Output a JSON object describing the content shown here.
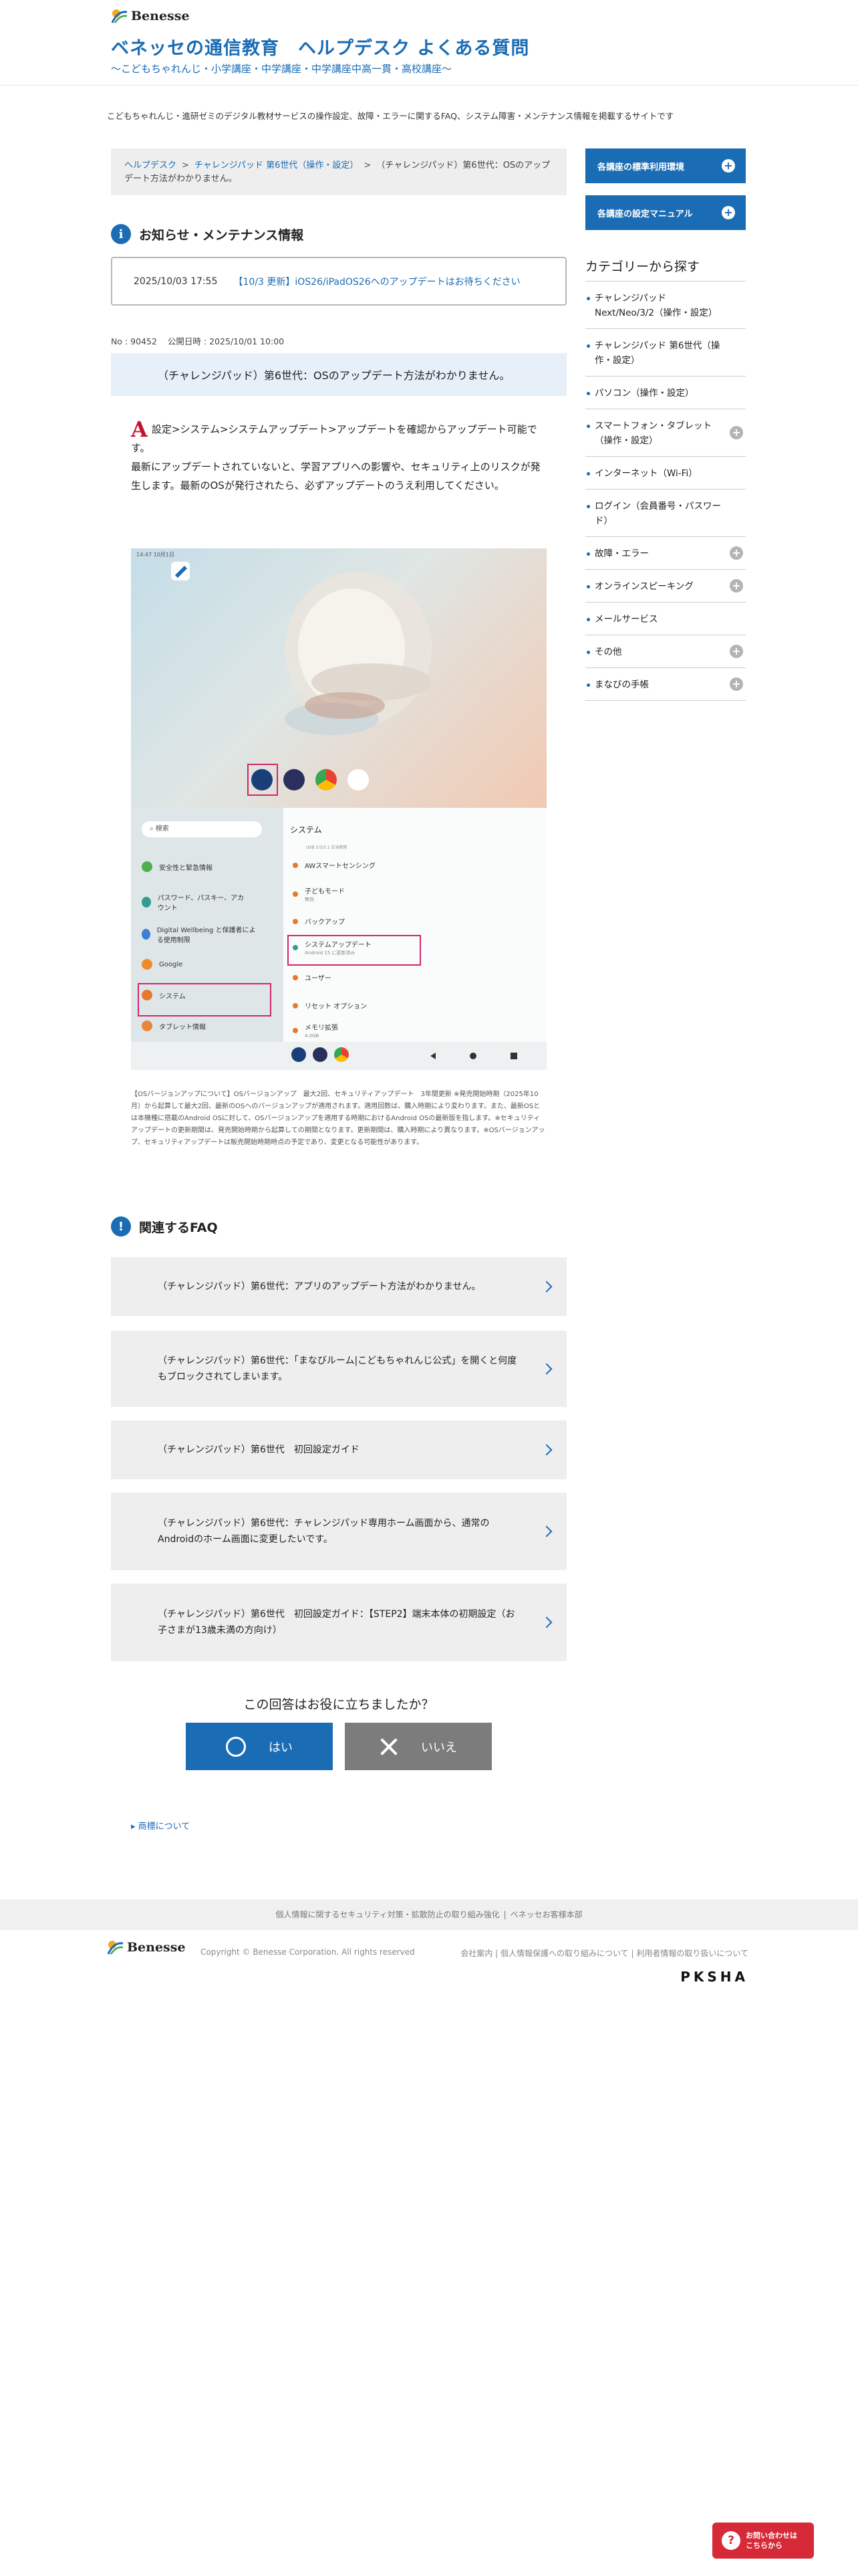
{
  "header": {
    "logo_text": "Benesse",
    "title": "ベネッセの通信教育　ヘルプデスク よくある質問",
    "subtitle": "〜こどもちゃれんじ・小学講座・中学講座・中学講座中高一貫・高校講座〜"
  },
  "intro": "こどもちゃれんじ・進研ゼミのデジタル教材サービスの操作設定、故障・エラーに関するFAQ、システム障害・メンテナンス情報を掲載するサイトです",
  "breadcrumb": {
    "home": "ヘルプデスク",
    "category": "チャレンジパッド 第6世代（操作・設定）",
    "current": "（チャレンジパッド）第6世代：OSのアップデート方法がわかりません。"
  },
  "notice": {
    "heading": "お知らせ・メンテナンス情報",
    "date": "2025/10/03 17:55",
    "link": "【10/3 更新】iOS26/iPadOS26へのアップデートはお待ちください"
  },
  "meta": {
    "no": "No : 90452",
    "published": "公開日時 : 2025/10/01 10:00"
  },
  "question": "（チャレンジパッド）第6世代：OSのアップデート方法がわかりません。",
  "answer": {
    "label": "A",
    "line1": "設定>システム>システムアップデート>アップデートを確認からアップデート可能です。",
    "line2": "最新にアップデートされていないと、学習アプリへの影響や、セキュリティ上のリスクが発生します。最新のOSが発行されたら、必ずアップデートのうえ利用してください。"
  },
  "screenshot": {
    "status_left": "14:47 10月1日",
    "search": "検索",
    "panel_title": "システム",
    "side_items": [
      "安全性と緊急情報",
      "パスワード、パスキー、アカウント",
      "Digital Wellbeing と保護者による使用制限",
      "Google",
      "システム",
      "タブレット情報"
    ],
    "main_items": [
      "AWスマートセンシング",
      "子どもモード",
      "バックアップ",
      "システムアップデート",
      "ユーザー",
      "リセット オプション",
      "メモリ拡張"
    ],
    "main_subs": [
      "",
      "無効",
      "",
      "Android 15 に更新済み",
      "",
      "",
      "4.0GB"
    ],
    "main_top_hint": "USB 3.0/3.1 正当使用"
  },
  "footnote": "【OSバージョンアップについて】OSバージョンアップ　最大2回、セキュリティアップデート　3年間更新 ※発売開始時期（2025年10月）から起算して最大2回、最新のOSへのバージョンアップが適用されます。適用回数は、購入時期により変わります。また、最新OSとは本機種に搭載のAndroid OSに対して、OSバージョンアップを適用する時期におけるAndroid OSの最新版を指します。※セキュリティアップデートの更新期間は、発売開始時期から起算しての期間となります。更新期間は、購入時期により異なります。※OSバージョンアップ、セキュリティアップデートは販売開始時期時点の予定であり、変更となる可能性があります。",
  "faq": {
    "heading": "関連するFAQ",
    "items": [
      "（チャレンジパッド）第6世代：アプリのアップデート方法がわかりません。",
      "（チャレンジパッド）第6世代：「まなびルーム|こどもちゃれんじ公式」を開くと何度もブロックされてしまいます。",
      "（チャレンジパッド）第6世代　初回設定ガイド",
      "（チャレンジパッド）第6世代：チャレンジパッド専用ホーム画面から、通常のAndroidのホーム画面に変更したいです。",
      "（チャレンジパッド）第6世代　初回設定ガイド：【STEP2】端末本体の初期設定（お子さまが13歳未満の方向け）"
    ]
  },
  "feedback": {
    "question": "この回答はお役に立ちましたか？",
    "yes": "はい",
    "no": "いいえ"
  },
  "trademark": "商標について",
  "footer": {
    "links": [
      "個人情報に関するセキュリティ対策・拡散防止の取り組み強化",
      "ベネッセお客様本部"
    ],
    "logo_text": "Benesse",
    "copyright": "Copyright © Benesse Corporation. All rights reserved",
    "corp_links": [
      "会社案内",
      "個人情報保護への取り組みについて",
      "利用者情報の取り扱いについて"
    ],
    "brand": "PKSHA"
  },
  "sidebar": {
    "buttons": [
      "各講座の標準利用環境",
      "各講座の設定マニュアル"
    ],
    "category_title": "カテゴリーから探す",
    "categories": [
      {
        "label": "チャレンジパッド Next/Neo/3/2（操作・設定）",
        "expand": false
      },
      {
        "label": "チャレンジパッド 第6世代（操作・設定）",
        "expand": false
      },
      {
        "label": "パソコン（操作・設定）",
        "expand": false
      },
      {
        "label": "スマートフォン・タブレット（操作・設定）",
        "expand": true
      },
      {
        "label": "インターネット（Wi-Fi）",
        "expand": false
      },
      {
        "label": "ログイン（会員番号・パスワード）",
        "expand": false
      },
      {
        "label": "故障・エラー",
        "expand": true
      },
      {
        "label": "オンラインスピーキング",
        "expand": true
      },
      {
        "label": "メールサービス",
        "expand": false
      },
      {
        "label": "その他",
        "expand": true
      },
      {
        "label": "まなびの手帳",
        "expand": true
      }
    ]
  },
  "contact": {
    "line1": "お問い合わせは",
    "line2": "こちらから"
  },
  "colors": {
    "brand_blue": "#1a6cb5",
    "highlight_red": "#d4246e",
    "contact_red": "#d62a38"
  }
}
